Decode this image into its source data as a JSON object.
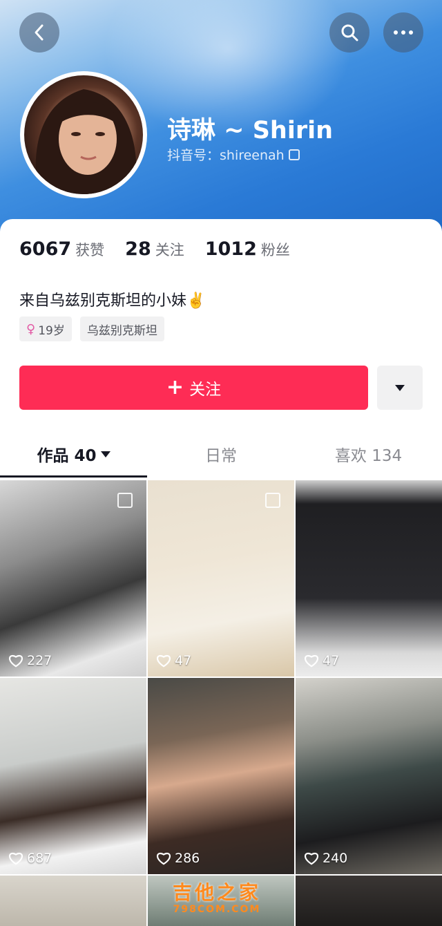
{
  "header": {
    "name": "诗琳 ~ Shirin",
    "douyin_id": "抖音号：shireenah"
  },
  "icons": {
    "back": "chevron-left-icon",
    "search": "search-icon",
    "more": "more-horizontal-icon",
    "copy": "copy-icon",
    "heart": "heart-outline-icon",
    "female": "female-icon"
  },
  "stats": [
    {
      "value": "6067",
      "label": "获赞"
    },
    {
      "value": "28",
      "label": "关注"
    },
    {
      "value": "1012",
      "label": "粉丝"
    }
  ],
  "bio": "来自乌兹别克斯坦的小妹✌️",
  "tags": {
    "age": "19岁",
    "location": "乌兹别克斯坦"
  },
  "follow_button": "关注",
  "tabs": {
    "works": "作品 40",
    "daily": "日常",
    "likes": "喜欢 134"
  },
  "videos": [
    {
      "likes": "227"
    },
    {
      "likes": "47"
    },
    {
      "likes": "47"
    },
    {
      "likes": "687"
    },
    {
      "likes": "286"
    },
    {
      "likes": "240"
    }
  ],
  "watermark": {
    "cn": "吉他之家",
    "en": "798COM.COM"
  },
  "colors": {
    "accent": "#fe2c55",
    "header_blue": "#2a7ad6"
  }
}
